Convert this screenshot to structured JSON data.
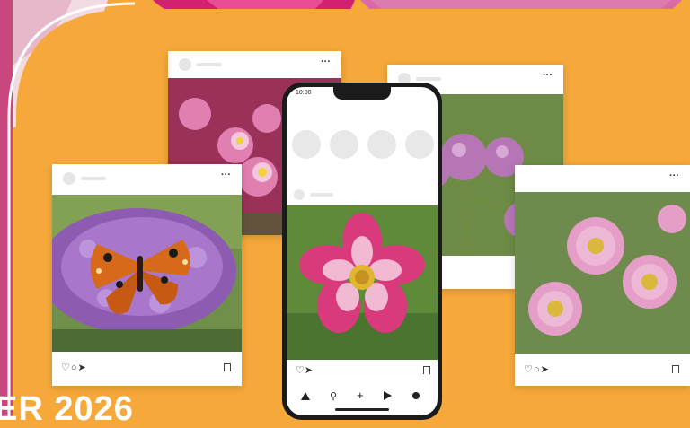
{
  "phone": {
    "status_time": "10:00",
    "nav_icons": [
      "home-icon",
      "search-icon",
      "add-icon",
      "reels-icon",
      "profile-icon"
    ]
  },
  "cards": [
    {
      "id": "card-butterfly",
      "actions": "♡ ○ ⊲",
      "more": "···"
    },
    {
      "id": "card-cosmos-pink",
      "actions": "",
      "more": "···"
    },
    {
      "id": "card-verbena",
      "actions": "♡ ○ ⊲",
      "more": "···"
    },
    {
      "id": "card-daisy",
      "actions": "♡ ○ ⊲",
      "more": "···"
    }
  ],
  "banner": {
    "text": "ER 2026"
  },
  "colors": {
    "background": "#f6a93a",
    "card": "#ffffff",
    "accent_pink": "#d6338a"
  }
}
